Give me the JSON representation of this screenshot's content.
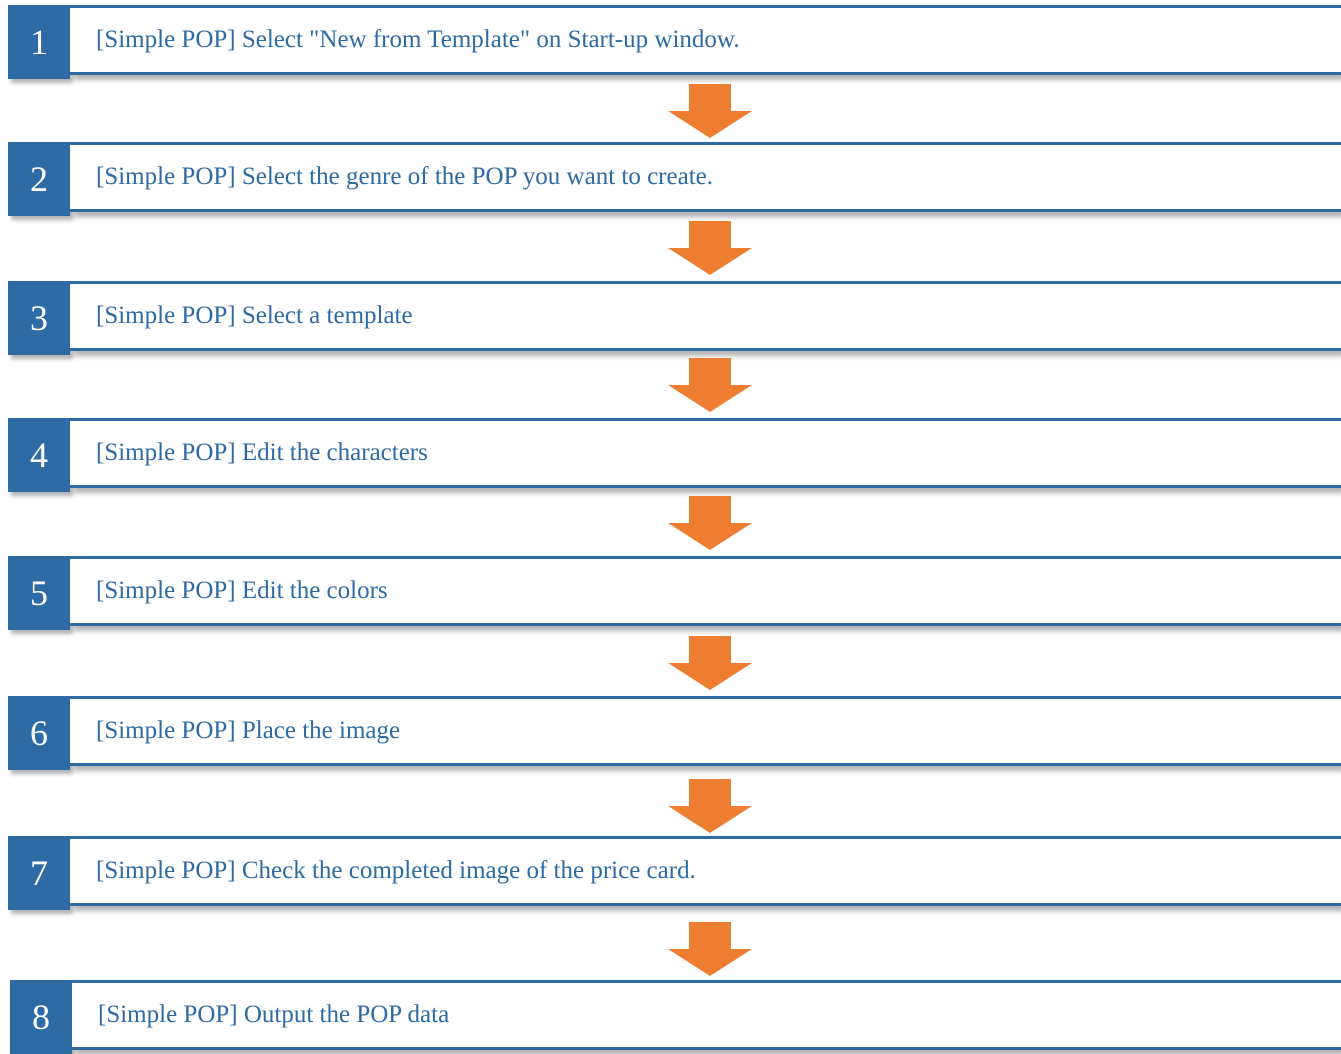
{
  "colors": {
    "accent": "#2e6aa4",
    "arrow": "#ed7d31",
    "badge_text": "#ffffff"
  },
  "steps": [
    {
      "number": "1",
      "label": "[Simple POP] Select \"New from Template\" on Start-up window."
    },
    {
      "number": "2",
      "label": "[Simple POP] Select the genre of the POP you want to create."
    },
    {
      "number": "3",
      "label": "[Simple POP] Select a template"
    },
    {
      "number": "4",
      "label": "[Simple POP] Edit the characters"
    },
    {
      "number": "5",
      "label": "[Simple POP] Edit the colors"
    },
    {
      "number": "6",
      "label": "[Simple POP] Place the image"
    },
    {
      "number": "7",
      "label": "[Simple POP] Check the completed image of the price card."
    },
    {
      "number": "8",
      "label": "[Simple POP] Output the POP data"
    }
  ]
}
